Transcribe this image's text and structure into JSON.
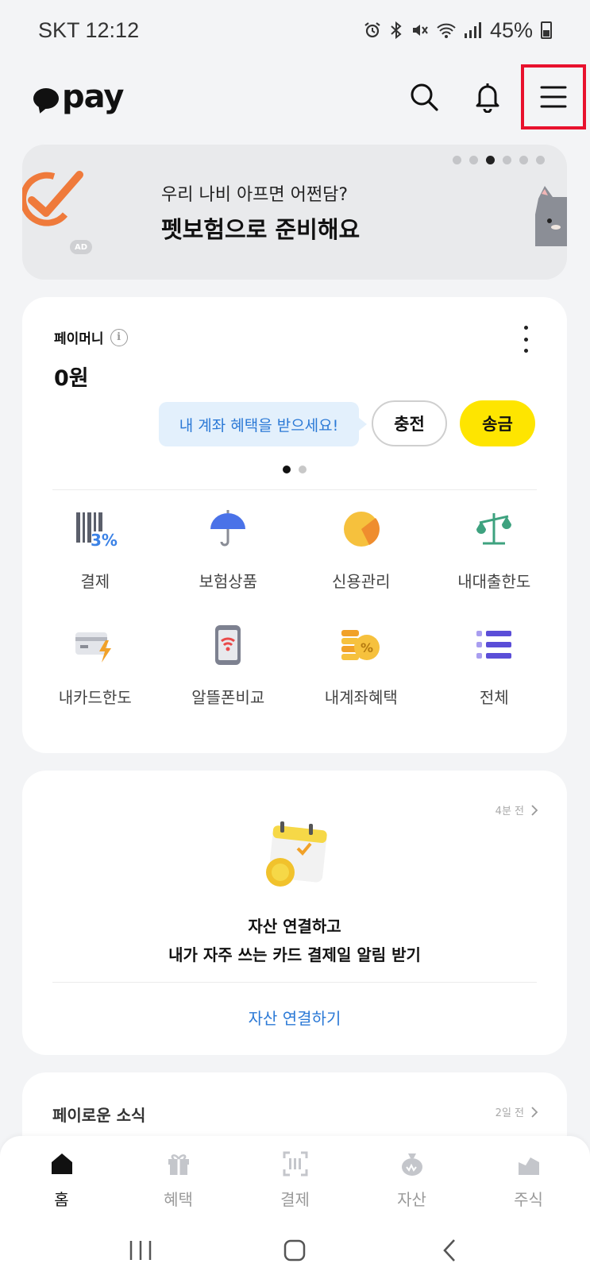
{
  "status_bar": {
    "carrier_time": "SKT 12:12",
    "battery": "45%",
    "icons": [
      "alarm-icon",
      "bluetooth-icon",
      "mute-icon",
      "wifi-icon",
      "signal-icon",
      "battery-icon"
    ]
  },
  "header": {
    "logo_text": "pay",
    "search_icon": "search-icon",
    "bell_icon": "bell-icon",
    "menu_icon": "menu-icon",
    "highlight_color": "#e8112d"
  },
  "ad_banner": {
    "subtitle": "우리 나비 아프면 어쩐담?",
    "title": "펫보험으로 준비해요",
    "badge": "AD",
    "dots_total": 6,
    "active_dot": 3
  },
  "pay_money": {
    "label": "페이머니",
    "amount": "0원",
    "tip": "내 계좌 혜택을 받으세요!",
    "charge_label": "충전",
    "send_label": "송금",
    "accent_color": "#fee500"
  },
  "services": [
    {
      "label": "결제",
      "icon": "barcode-discount-icon"
    },
    {
      "label": "보험상품",
      "icon": "umbrella-icon"
    },
    {
      "label": "신용관리",
      "icon": "credit-gauge-icon"
    },
    {
      "label": "내대출한도",
      "icon": "scale-icon"
    },
    {
      "label": "내카드한도",
      "icon": "card-bolt-icon"
    },
    {
      "label": "알뜰폰비교",
      "icon": "phone-wifi-icon"
    },
    {
      "label": "내계좌혜택",
      "icon": "coin-percent-icon"
    },
    {
      "label": "전체",
      "icon": "list-icon"
    }
  ],
  "asset_card": {
    "time": "4분 전",
    "line1": "자산 연결하고",
    "line2": "내가 자주 쓰는 카드 결제일 알림 받기",
    "link": "자산 연결하기"
  },
  "news_card": {
    "title": "페이로운 소식",
    "time": "2일 전"
  },
  "bottom_nav": [
    {
      "label": "홈",
      "icon": "home-icon",
      "active": true
    },
    {
      "label": "혜택",
      "icon": "gift-icon",
      "active": false
    },
    {
      "label": "결제",
      "icon": "scan-pay-icon",
      "active": false
    },
    {
      "label": "자산",
      "icon": "money-bag-icon",
      "active": false
    },
    {
      "label": "주식",
      "icon": "stock-chart-icon",
      "active": false
    }
  ]
}
